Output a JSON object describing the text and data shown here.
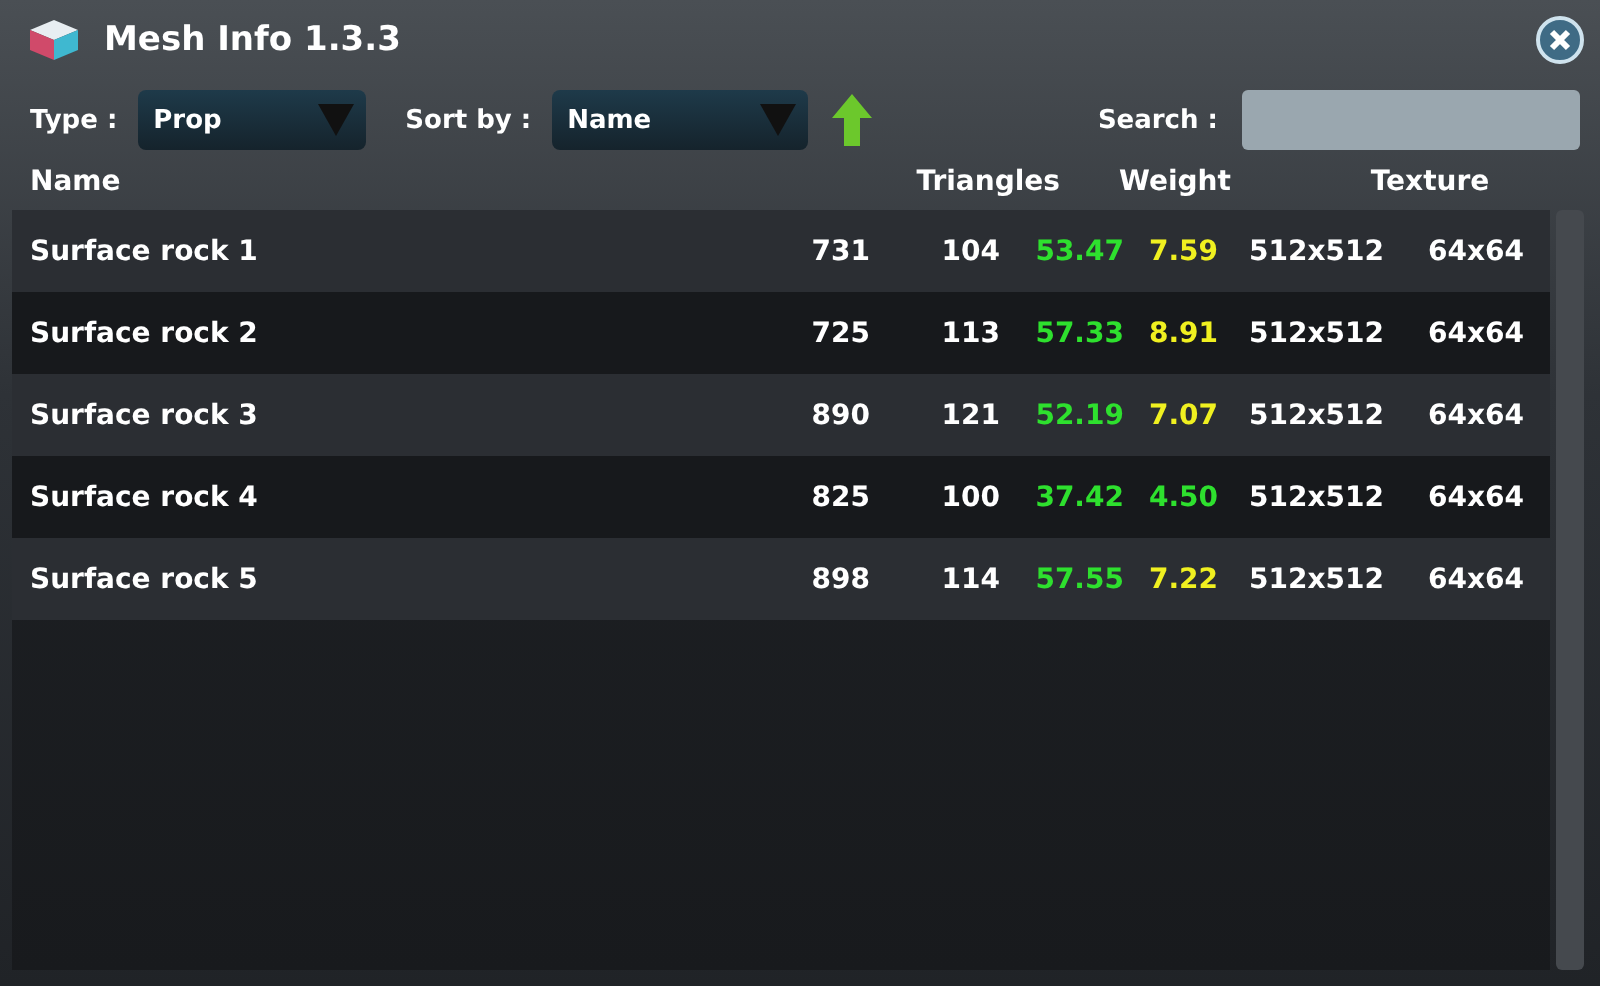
{
  "window": {
    "title": "Mesh Info 1.3.3"
  },
  "filters": {
    "type_label": "Type :",
    "type_value": "Prop",
    "sort_label": "Sort by :",
    "sort_value": "Name",
    "search_label": "Search :"
  },
  "table": {
    "columns": [
      "Name",
      "Triangles",
      "Weight",
      "Texture"
    ],
    "rows": [
      {
        "name": "Surface rock 1",
        "triangles": "731",
        "triangles_lod": "104",
        "weight": {
          "text": "53.47",
          "color": "#2ee02e"
        },
        "weight_lod": {
          "text": "7.59",
          "color": "#f0f020"
        },
        "texture": "512x512",
        "texture_lod": "64x64"
      },
      {
        "name": "Surface rock 2",
        "triangles": "725",
        "triangles_lod": "113",
        "weight": {
          "text": "57.33",
          "color": "#2ee02e"
        },
        "weight_lod": {
          "text": "8.91",
          "color": "#f0f020"
        },
        "texture": "512x512",
        "texture_lod": "64x64"
      },
      {
        "name": "Surface rock 3",
        "triangles": "890",
        "triangles_lod": "121",
        "weight": {
          "text": "52.19",
          "color": "#2ee02e"
        },
        "weight_lod": {
          "text": "7.07",
          "color": "#f0f020"
        },
        "texture": "512x512",
        "texture_lod": "64x64"
      },
      {
        "name": "Surface rock 4",
        "triangles": "825",
        "triangles_lod": "100",
        "weight": {
          "text": "37.42",
          "color": "#2ee02e"
        },
        "weight_lod": {
          "text": "4.50",
          "color": "#2ee02e"
        },
        "texture": "512x512",
        "texture_lod": "64x64"
      },
      {
        "name": "Surface rock 5",
        "triangles": "898",
        "triangles_lod": "114",
        "weight": {
          "text": "57.55",
          "color": "#2ee02e"
        },
        "weight_lod": {
          "text": "7.22",
          "color": "#f0f020"
        },
        "texture": "512x512",
        "texture_lod": "64x64"
      }
    ]
  }
}
